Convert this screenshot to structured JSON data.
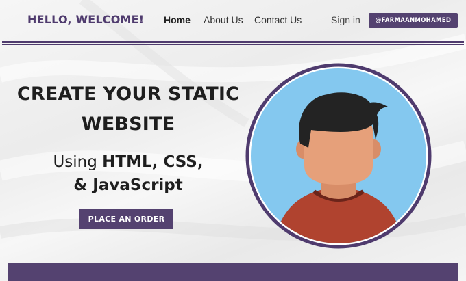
{
  "header": {
    "brand": "HELLO, WELCOME!",
    "nav": [
      {
        "label": "Home",
        "active": true
      },
      {
        "label": "About Us",
        "active": false
      },
      {
        "label": "Contact Us",
        "active": false
      }
    ],
    "signin": "Sign in",
    "handle": "@FARMAANMOHAMED"
  },
  "hero": {
    "title_line1": "CREATE YOUR STATIC",
    "title_line2": "WEBSITE",
    "sub_prefix": "Using ",
    "sub_bold1": "HTML, CSS,",
    "sub_bold2": "& JavaScript",
    "cta": "PLACE AN ORDER"
  },
  "colors": {
    "accent": "#544270",
    "brand_text": "#4f3b6e",
    "avatar_bg": "#84c8ef",
    "skin": "#e6a07a",
    "hair": "#232323",
    "shirt": "#b0432f"
  },
  "icons": {
    "avatar": "person-avatar-icon"
  }
}
